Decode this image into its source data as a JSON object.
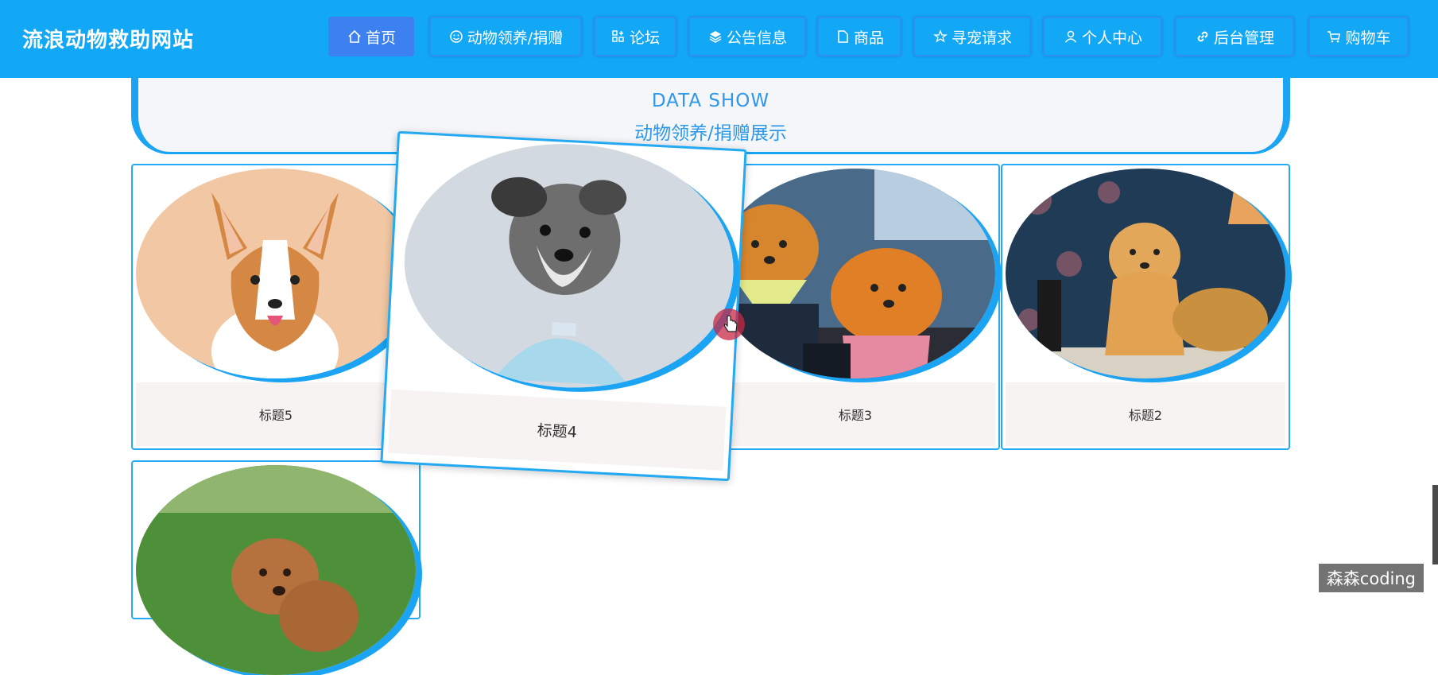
{
  "header": {
    "site_title": "流浪动物救助网站",
    "nav": [
      {
        "label": "首页",
        "icon": "home-icon",
        "active": true
      },
      {
        "label": "动物领养/捐赠",
        "icon": "smile-icon"
      },
      {
        "label": "论坛",
        "icon": "forum-icon"
      },
      {
        "label": "公告信息",
        "icon": "layers-icon"
      },
      {
        "label": "商品",
        "icon": "goods-icon"
      },
      {
        "label": "寻宠请求",
        "icon": "star-icon"
      },
      {
        "label": "个人中心",
        "icon": "user-icon"
      },
      {
        "label": "后台管理",
        "icon": "link-icon"
      },
      {
        "label": "购物车",
        "icon": "cart-icon"
      }
    ]
  },
  "banner": {
    "title_en": "DATA SHOW",
    "title_cn": "动物领养/捐赠展示"
  },
  "cards": [
    {
      "title": "标题5",
      "image": "corgi"
    },
    {
      "title": "标题4",
      "image": "schnauzer"
    },
    {
      "title": "标题3",
      "image": "pomeranians"
    },
    {
      "title": "标题2",
      "image": "puppy"
    },
    {
      "title": "",
      "image": "poodle"
    }
  ],
  "watermark": "森森coding",
  "colors": {
    "header_bg": "#12a8f5",
    "accent": "#1aa4f3",
    "active_nav": "#3d80f0",
    "banner_text": "#2d97e8"
  }
}
